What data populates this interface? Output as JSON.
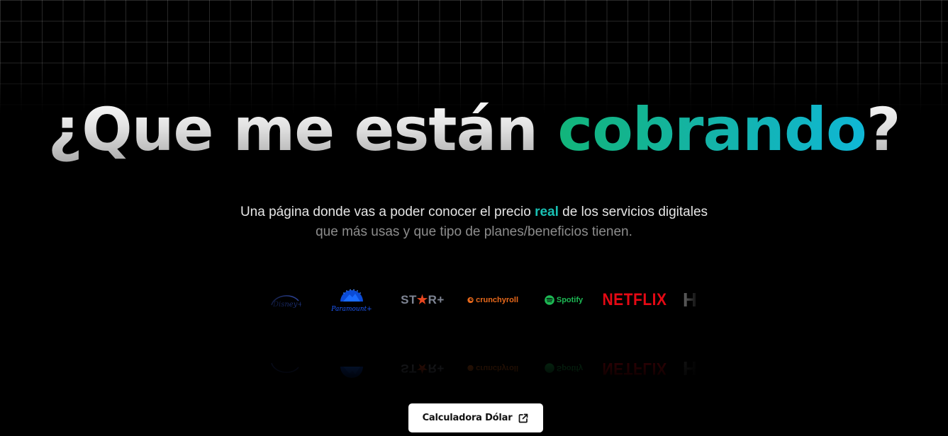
{
  "hero": {
    "title_part1": "¿Que me están ",
    "title_accent": "cobrando",
    "title_end": "?",
    "subtitle_line1_before": "Una página donde vas a poder conocer el precio ",
    "subtitle_highlight": "real",
    "subtitle_line1_after": " de los servicios digitales",
    "subtitle_line2": "que más usas y que tipo de planes/beneficios tienen."
  },
  "services": {
    "disney": "Disney+",
    "paramount": "Paramount+",
    "star_prefix": "ST",
    "star_symbol": "★",
    "star_suffix": "R+",
    "crunchyroll": "crunchyroll",
    "spotify": "Spotify",
    "netflix": "NETFLIX",
    "hbo": "H"
  },
  "cta": {
    "label": "Calculadora Dólar",
    "icon": "external-link-icon"
  },
  "colors": {
    "background": "#000000",
    "accent_start": "#12b57a",
    "accent_end": "#0fb7d6",
    "highlight": "#19c0b4",
    "netflix": "#e50914",
    "spotify": "#1db954",
    "crunchyroll": "#e9691b",
    "paramount": "#0b4bd6"
  }
}
